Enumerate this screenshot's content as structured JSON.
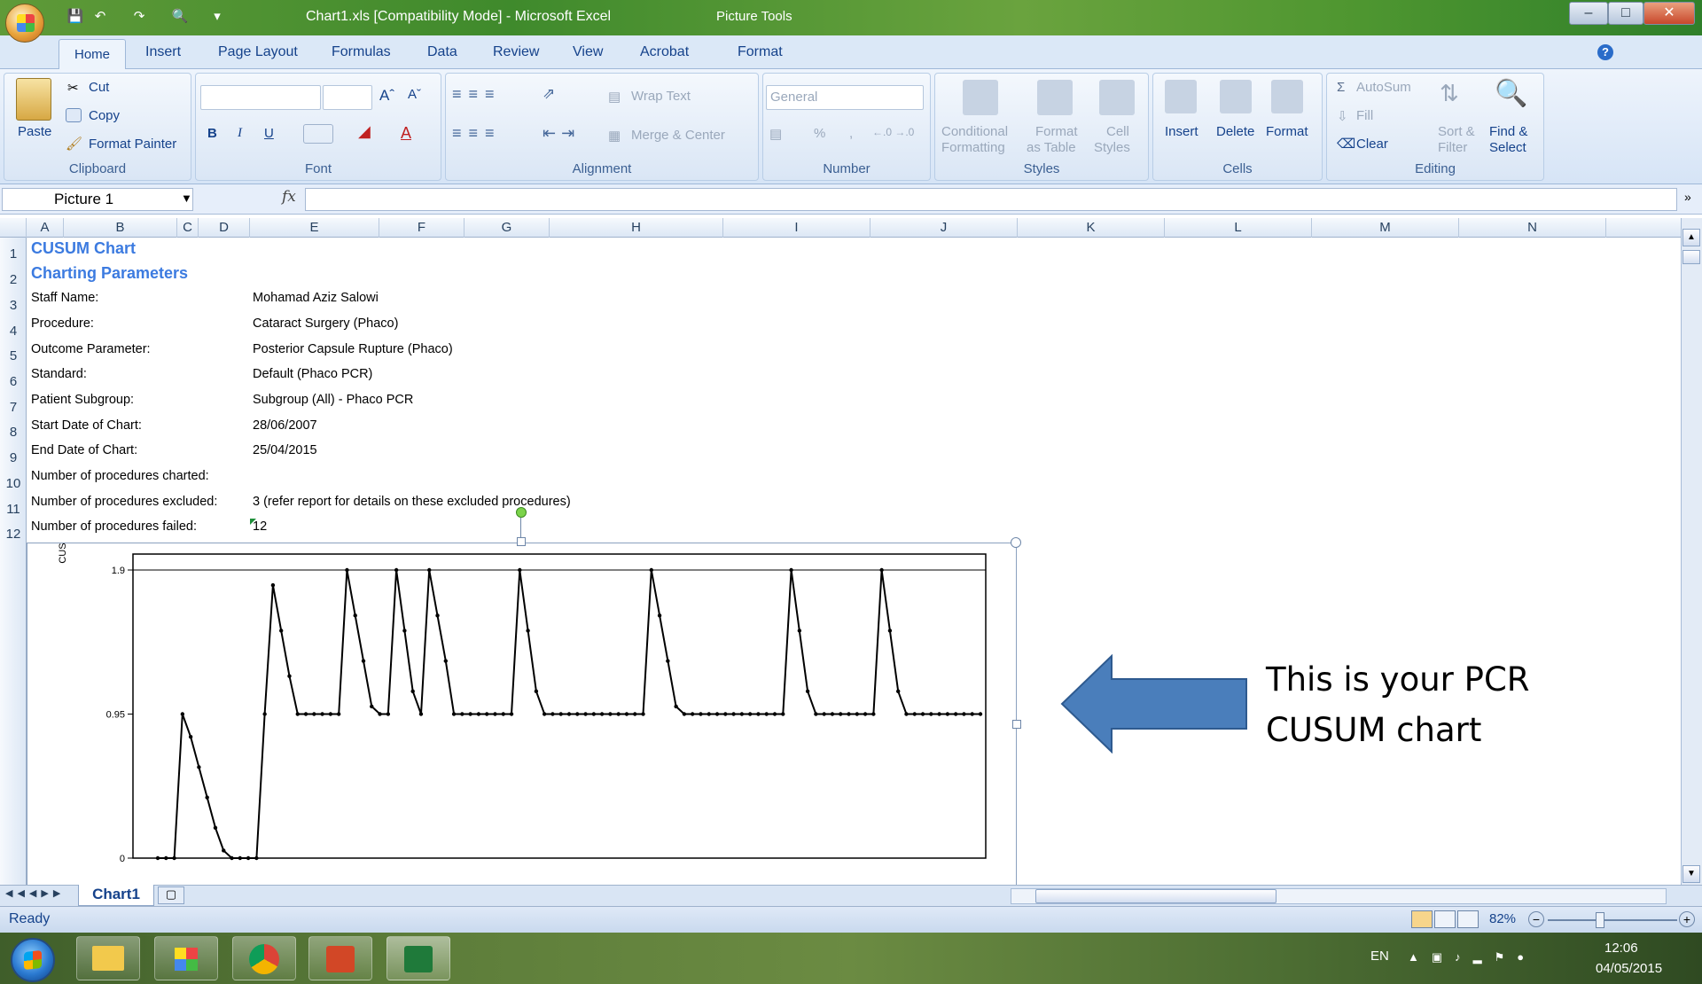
{
  "window": {
    "title": "Chart1.xls  [Compatibility Mode]  -  Microsoft Excel",
    "context_tab": "Picture Tools"
  },
  "ribbon": {
    "tabs": [
      "Home",
      "Insert",
      "Page Layout",
      "Formulas",
      "Data",
      "Review",
      "View",
      "Acrobat",
      "Format"
    ],
    "clipboard": {
      "paste": "Paste",
      "cut": "Cut",
      "copy": "Copy",
      "format_painter": "Format Painter",
      "label": "Clipboard"
    },
    "font": {
      "label": "Font",
      "bold": "B",
      "italic": "I",
      "underline": "U",
      "grow": "Aˆ",
      "shrink": "Aˇ",
      "font_color": "A"
    },
    "alignment": {
      "label": "Alignment",
      "wrap": "Wrap Text",
      "merge": "Merge & Center"
    },
    "number": {
      "label": "Number",
      "format": "General",
      "percent": "%",
      "comma": ","
    },
    "styles": {
      "label": "Styles",
      "conditional_1": "Conditional",
      "conditional_2": "Formatting",
      "format_table_1": "Format",
      "format_table_2": "as Table",
      "cell_styles_1": "Cell",
      "cell_styles_2": "Styles"
    },
    "cells": {
      "label": "Cells",
      "insert": "Insert",
      "delete": "Delete",
      "format": "Format"
    },
    "editing": {
      "label": "Editing",
      "autosum": "AutoSum",
      "fill": "Fill",
      "clear": "Clear",
      "sort_1": "Sort &",
      "sort_2": "Filter",
      "find_1": "Find &",
      "find_2": "Select"
    }
  },
  "formula_bar": {
    "name_box": "Picture 1",
    "fx": "fx",
    "value": ""
  },
  "columns": [
    "A",
    "B",
    "C",
    "D",
    "E",
    "F",
    "G",
    "H",
    "I",
    "J",
    "K",
    "L",
    "M",
    "N"
  ],
  "rows": [
    "1",
    "2",
    "3",
    "4",
    "5",
    "6",
    "7",
    "8",
    "9",
    "10",
    "11",
    "12"
  ],
  "sheet": {
    "title": "CUSUM Chart",
    "subtitle": "Charting Parameters",
    "params": [
      {
        "label": "Staff Name:",
        "value": "Mohamad Aziz Salowi"
      },
      {
        "label": "Procedure:",
        "value": "Cataract Surgery (Phaco)"
      },
      {
        "label": "Outcome Parameter:",
        "value": "Posterior Capsule Rupture (Phaco)"
      },
      {
        "label": "Standard:",
        "value": "Default (Phaco PCR)"
      },
      {
        "label": "Patient Subgroup:",
        "value": "Subgroup (All) - Phaco PCR"
      },
      {
        "label": "Start Date of Chart:",
        "value": "28/06/2007"
      },
      {
        "label": "End Date of Chart:",
        "value": "25/04/2015"
      },
      {
        "label": "Number of procedures charted:",
        "value": ""
      },
      {
        "label": "Number of procedures excluded:",
        "value": "3 (refer report for details on these excluded procedures)"
      },
      {
        "label": "Number of procedures failed:",
        "value": "12"
      }
    ]
  },
  "chart_data": {
    "type": "line",
    "ylabel": "CUSUM",
    "ylim": [
      0,
      1.9
    ],
    "yticks": [
      0,
      0.95,
      1.9
    ],
    "grid": false,
    "series": [
      {
        "x": [
          0,
          1,
          2,
          3,
          4,
          5,
          6,
          7,
          8,
          9,
          10,
          11,
          12,
          13,
          14,
          15,
          16,
          17,
          18,
          19,
          20,
          21,
          22,
          23,
          24,
          25,
          26,
          27,
          28,
          29,
          30,
          31,
          32,
          33,
          34,
          35,
          36,
          37,
          38,
          39,
          40,
          41,
          42,
          43,
          44,
          45,
          46,
          47,
          48,
          49,
          50,
          51,
          52,
          53,
          54,
          55,
          56,
          57,
          58,
          59,
          60,
          61,
          62,
          63,
          64,
          65,
          66,
          67,
          68,
          69,
          70,
          71,
          72,
          73,
          74,
          75,
          76,
          77,
          78,
          79,
          80,
          81,
          82,
          83,
          84,
          85,
          86,
          87,
          88,
          89,
          90,
          91,
          92,
          93,
          94,
          95,
          96,
          97,
          98,
          99,
          100
        ],
        "y": [
          0,
          0,
          0,
          0.95,
          0.8,
          0.6,
          0.4,
          0.2,
          0.05,
          0,
          0,
          0,
          0,
          0.95,
          1.8,
          1.5,
          1.2,
          0.95,
          0.95,
          0.95,
          0.95,
          0.95,
          0.95,
          1.9,
          1.6,
          1.3,
          1.0,
          0.95,
          0.95,
          1.9,
          1.5,
          1.1,
          0.95,
          1.9,
          1.6,
          1.3,
          0.95,
          0.95,
          0.95,
          0.95,
          0.95,
          0.95,
          0.95,
          0.95,
          1.9,
          1.5,
          1.1,
          0.95,
          0.95,
          0.95,
          0.95,
          0.95,
          0.95,
          0.95,
          0.95,
          0.95,
          0.95,
          0.95,
          0.95,
          0.95,
          1.9,
          1.6,
          1.3,
          1.0,
          0.95,
          0.95,
          0.95,
          0.95,
          0.95,
          0.95,
          0.95,
          0.95,
          0.95,
          0.95,
          0.95,
          0.95,
          0.95,
          1.9,
          1.5,
          1.1,
          0.95,
          0.95,
          0.95,
          0.95,
          0.95,
          0.95,
          0.95,
          0.95,
          1.9,
          1.5,
          1.1,
          0.95,
          0.95,
          0.95,
          0.95,
          0.95,
          0.95,
          0.95,
          0.95,
          0.95,
          0.95
        ]
      }
    ]
  },
  "sheet_tabs": {
    "active": "Chart1"
  },
  "status": {
    "text": "Ready",
    "zoom": "82%"
  },
  "annotation": {
    "line1": "This is your PCR",
    "line2": "CUSUM chart"
  },
  "taskbar": {
    "lang": "EN",
    "time": "12:06",
    "date": "04/05/2015"
  },
  "colors": {
    "accent": "#3c7be0",
    "arrow": "#4a7ebb",
    "arrow_border": "#2e5a8f"
  }
}
